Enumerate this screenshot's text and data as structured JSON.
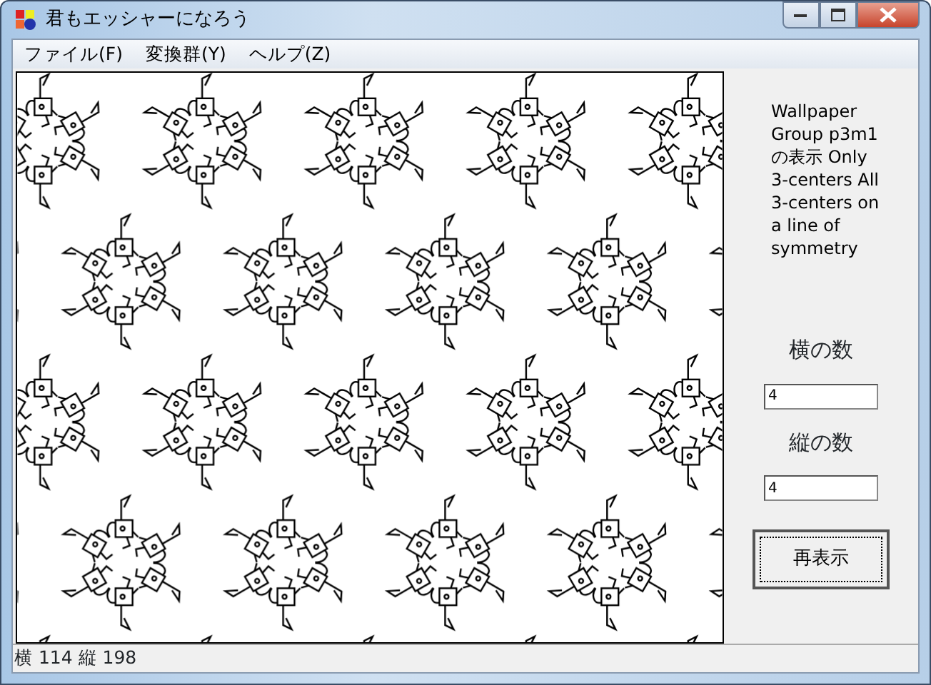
{
  "window": {
    "title": "君もエッシャーになろう"
  },
  "menu": [
    {
      "label": "ファイル(F)"
    },
    {
      "label": "変換群(Y)"
    },
    {
      "label": "ヘルプ(Z)"
    }
  ],
  "description": "Wallpaper Group p3m1 の表示 Only 3-centers All 3-centers on a line of symmetry",
  "fields": [
    {
      "label": "横の数",
      "value": "4"
    },
    {
      "label": "縦の数",
      "value": "4"
    }
  ],
  "redraw_button": "再表示",
  "status_bar": "横 114 縦 198"
}
